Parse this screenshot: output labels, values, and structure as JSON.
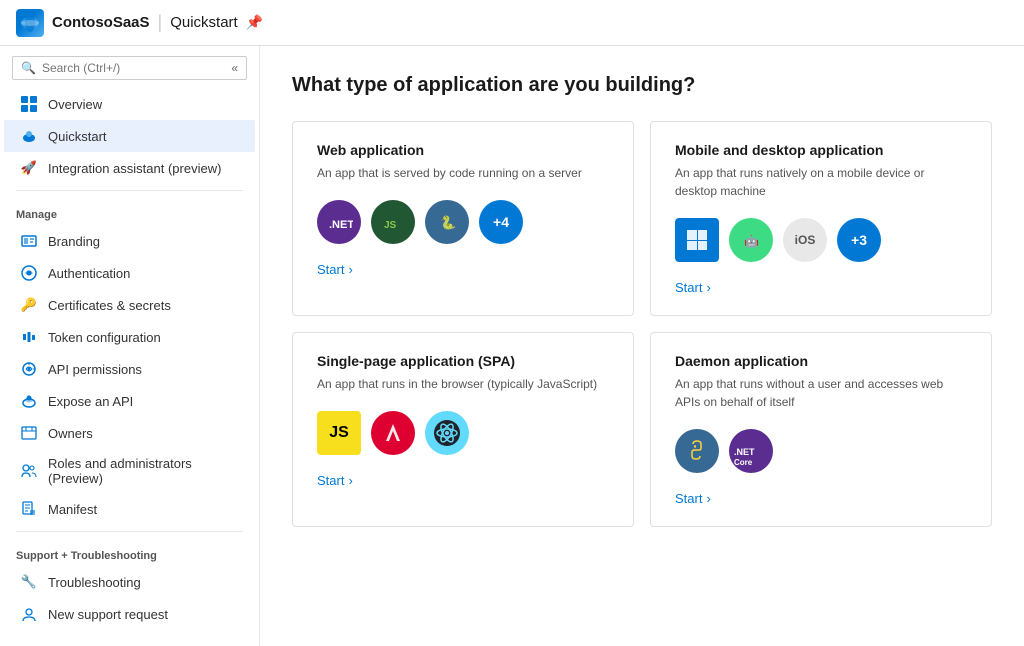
{
  "topbar": {
    "logo_alt": "Azure logo",
    "title": "ContosoSaaS",
    "separator": "|",
    "subtitle": "Quickstart",
    "pin_icon": "📌"
  },
  "sidebar": {
    "search_placeholder": "Search (Ctrl+/)",
    "collapse_icon": "«",
    "items_top": [
      {
        "id": "overview",
        "label": "Overview",
        "icon": "grid"
      },
      {
        "id": "quickstart",
        "label": "Quickstart",
        "icon": "cloud",
        "active": true
      },
      {
        "id": "integration",
        "label": "Integration assistant (preview)",
        "icon": "rocket"
      }
    ],
    "manage_section": "Manage",
    "items_manage": [
      {
        "id": "branding",
        "label": "Branding",
        "icon": "branding"
      },
      {
        "id": "authentication",
        "label": "Authentication",
        "icon": "auth"
      },
      {
        "id": "certs",
        "label": "Certificates & secrets",
        "icon": "key"
      },
      {
        "id": "token",
        "label": "Token configuration",
        "icon": "token"
      },
      {
        "id": "api-perms",
        "label": "API permissions",
        "icon": "api"
      },
      {
        "id": "expose-api",
        "label": "Expose an API",
        "icon": "expose"
      },
      {
        "id": "owners",
        "label": "Owners",
        "icon": "owners"
      },
      {
        "id": "roles",
        "label": "Roles and administrators (Preview)",
        "icon": "roles"
      },
      {
        "id": "manifest",
        "label": "Manifest",
        "icon": "manifest"
      }
    ],
    "support_section": "Support + Troubleshooting",
    "items_support": [
      {
        "id": "troubleshooting",
        "label": "Troubleshooting",
        "icon": "wrench"
      },
      {
        "id": "support",
        "label": "New support request",
        "icon": "support"
      }
    ]
  },
  "main": {
    "title": "What type of application are you building?",
    "cards": [
      {
        "id": "web",
        "title": "Web application",
        "description": "An app that is served by code running on a server",
        "icons": [
          {
            "type": "dotnet",
            "label": ".NET"
          },
          {
            "type": "nodejs",
            "label": "Node"
          },
          {
            "type": "python",
            "label": "Py"
          },
          {
            "type": "plus4",
            "label": "+4"
          }
        ],
        "start_label": "Start",
        "start_arrow": "›"
      },
      {
        "id": "mobile",
        "title": "Mobile and desktop application",
        "description": "An app that runs natively on a mobile device or desktop machine",
        "icons": [
          {
            "type": "windows",
            "label": "Win"
          },
          {
            "type": "android",
            "label": "And"
          },
          {
            "type": "ios",
            "label": "iOS"
          },
          {
            "type": "plus3",
            "label": "+3"
          }
        ],
        "start_label": "Start",
        "start_arrow": "›"
      },
      {
        "id": "spa",
        "title": "Single-page application (SPA)",
        "description": "An app that runs in the browser (typically JavaScript)",
        "icons": [
          {
            "type": "js",
            "label": "JS"
          },
          {
            "type": "angular",
            "label": "Ang"
          },
          {
            "type": "react",
            "label": "Re"
          }
        ],
        "start_label": "Start",
        "start_arrow": "›"
      },
      {
        "id": "daemon",
        "title": "Daemon application",
        "description": "An app that runs without a user and accesses web APIs on behalf of itself",
        "icons": [
          {
            "type": "python2",
            "label": "Py"
          },
          {
            "type": "dotnetcore",
            "label": ".NET Core"
          }
        ],
        "start_label": "Start",
        "start_arrow": "›"
      }
    ]
  }
}
